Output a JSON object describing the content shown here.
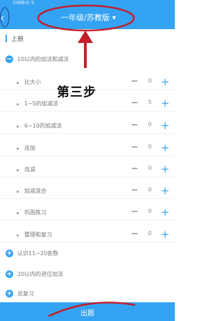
{
  "status": {
    "carrier": "中国移动 令",
    "time": "",
    "battery": ""
  },
  "header": {
    "back_icon": "‹",
    "title": "一年级/苏教版",
    "caret": "▼"
  },
  "section": {
    "label": "上册"
  },
  "units": [
    {
      "label": "10以内的加法和减法",
      "icon": "−"
    },
    {
      "label": "认识11~20各数",
      "icon": "+"
    },
    {
      "label": "20以内的进位加法",
      "icon": "+"
    },
    {
      "label": "总复习",
      "icon": "+"
    }
  ],
  "rows": [
    {
      "label": "比大小",
      "count": "0"
    },
    {
      "label": "1~5的加减法",
      "count": "5"
    },
    {
      "label": "6~10的加减法",
      "count": "0"
    },
    {
      "label": "连加",
      "count": "0"
    },
    {
      "label": "连减",
      "count": "0"
    },
    {
      "label": "加减混合",
      "count": "0"
    },
    {
      "label": "巩固练习",
      "count": "0"
    },
    {
      "label": "整理和复习",
      "count": "0"
    }
  ],
  "controls": {
    "minus": "−",
    "plus": "+"
  },
  "bottom": {
    "label": "出题"
  },
  "annotation": {
    "text": "第三步",
    "color": "#c41e2a"
  },
  "colors": {
    "primary": "#34a3f3",
    "annotation": "#c41e2a"
  }
}
